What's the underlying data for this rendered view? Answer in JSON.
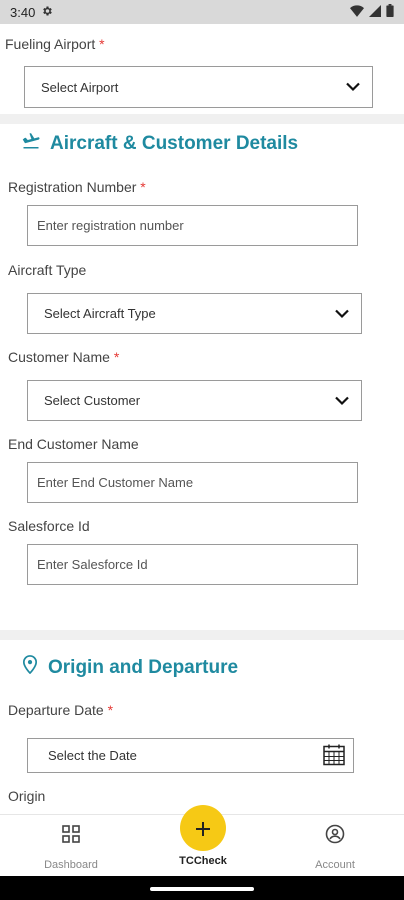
{
  "status_bar": {
    "time": "3:40"
  },
  "fueling": {
    "label": "Fueling Airport",
    "required": "*",
    "select_value": "Select Airport"
  },
  "aircraft_section": {
    "title": "Aircraft & Customer Details",
    "registration": {
      "label": "Registration Number",
      "required": "*",
      "placeholder": "Enter registration number"
    },
    "aircraft_type": {
      "label": "Aircraft Type",
      "select_value": "Select Aircraft Type"
    },
    "customer": {
      "label": "Customer Name",
      "required": "*",
      "select_value": "Select Customer"
    },
    "end_customer": {
      "label": "End Customer Name",
      "placeholder": "Enter End Customer Name"
    },
    "salesforce": {
      "label": "Salesforce Id",
      "placeholder": "Enter Salesforce Id"
    }
  },
  "origin_section": {
    "title": "Origin and Departure",
    "departure": {
      "label": "Departure Date",
      "required": "*",
      "placeholder": "Select the Date"
    },
    "origin": {
      "label": "Origin"
    }
  },
  "bottom_nav": {
    "dashboard": "Dashboard",
    "tccheck": "TCCheck",
    "account": "Account"
  },
  "colors": {
    "accent": "#1f8aa0",
    "required": "#e53935",
    "fab": "#f6c915"
  }
}
